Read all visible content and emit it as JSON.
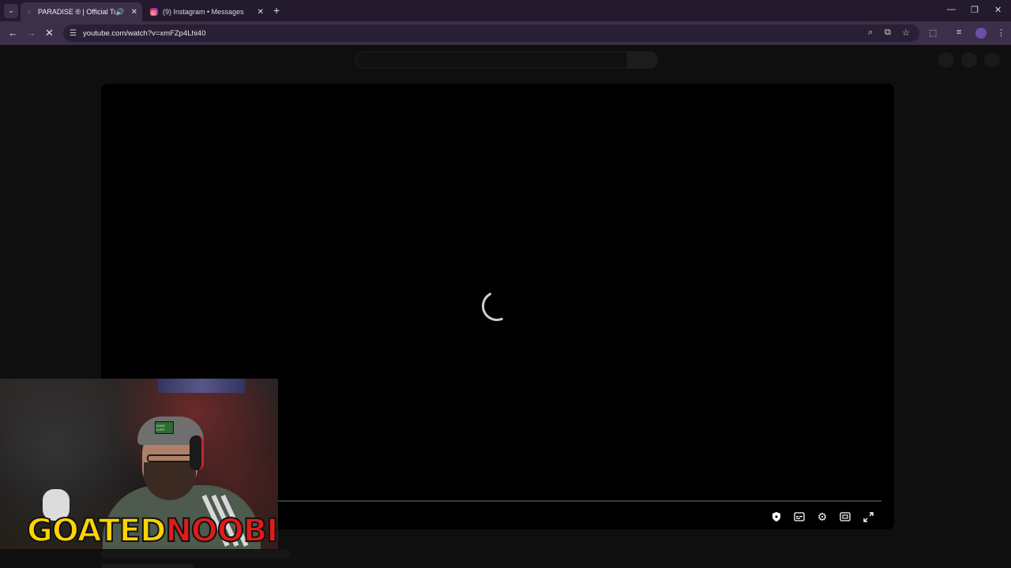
{
  "browser": {
    "tabs": [
      {
        "title": "PARADISE ® | Official Trailer",
        "active": true,
        "audio_icon": "speaker-icon"
      },
      {
        "title": "(9) Instagram • Messages",
        "active": false,
        "favicon": "instagram-icon"
      }
    ],
    "new_tab_label": "+",
    "url": "youtube.com/watch?v=xmFZp4Lhi40"
  },
  "player": {
    "state": "loading",
    "controls": [
      "shield-icon",
      "subtitles-icon",
      "settings-icon",
      "theater-icon",
      "fullscreen-icon"
    ]
  },
  "overlay": {
    "logo_part1": "GOATED",
    "logo_part2": "NOOBIE",
    "cap_patch": "GAME OVER"
  },
  "colors": {
    "tab_bar": "#231a2d",
    "toolbar": "#3b2f49",
    "page_bg": "#0f0f0f",
    "logo_yellow": "#ffd400",
    "logo_red": "#e21b1b"
  }
}
